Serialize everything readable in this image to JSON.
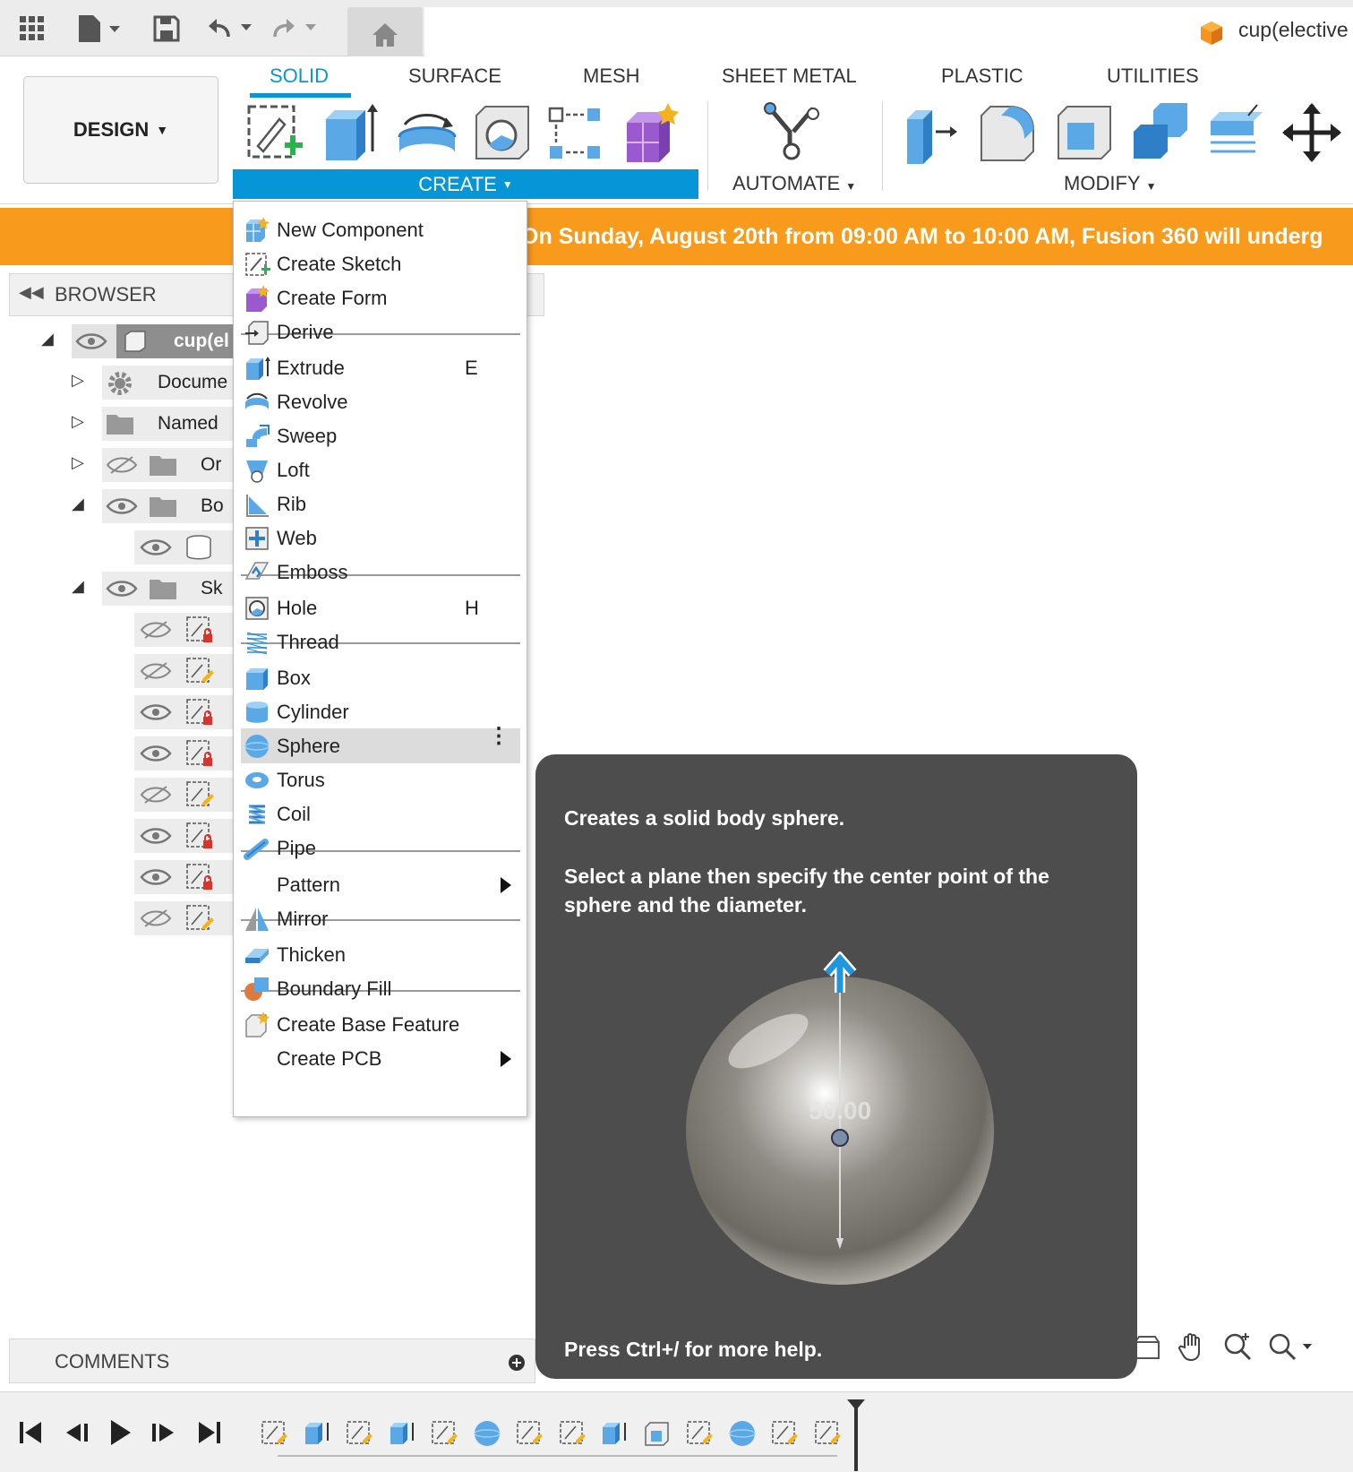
{
  "document": {
    "title": "cup(elective"
  },
  "workspace": {
    "label": "DESIGN"
  },
  "tabs": [
    {
      "label": "SOLID",
      "active": true
    },
    {
      "label": "SURFACE"
    },
    {
      "label": "MESH"
    },
    {
      "label": "SHEET METAL"
    },
    {
      "label": "PLASTIC"
    },
    {
      "label": "UTILITIES"
    }
  ],
  "groups": {
    "create": "CREATE",
    "automate": "AUTOMATE",
    "modify": "MODIFY"
  },
  "banner": {
    "text": "On Sunday, August 20th from 09:00 AM to 10:00 AM, Fusion 360 will underg"
  },
  "browser": {
    "title": "BROWSER",
    "items": [
      {
        "label": "cup(el",
        "icon": "component-icon"
      },
      {
        "label": "Docume",
        "icon": "gear-icon"
      },
      {
        "label": "Named",
        "icon": "folder-icon"
      },
      {
        "label": "Or",
        "icon": "folder-icon"
      },
      {
        "label": "Bo",
        "icon": "folder-icon"
      },
      {
        "label": "Sk",
        "icon": "folder-icon"
      }
    ]
  },
  "menu": {
    "items": [
      {
        "label": "New Component",
        "icon": "new-component-icon"
      },
      {
        "label": "Create Sketch",
        "icon": "create-sketch-icon"
      },
      {
        "label": "Create Form",
        "icon": "create-form-icon"
      },
      {
        "label": "Derive",
        "icon": "derive-icon"
      },
      {
        "label": "Extrude",
        "shortcut": "E",
        "icon": "extrude-icon"
      },
      {
        "label": "Revolve",
        "icon": "revolve-icon"
      },
      {
        "label": "Sweep",
        "icon": "sweep-icon"
      },
      {
        "label": "Loft",
        "icon": "loft-icon"
      },
      {
        "label": "Rib",
        "icon": "rib-icon"
      },
      {
        "label": "Web",
        "icon": "web-icon"
      },
      {
        "label": "Emboss",
        "icon": "emboss-icon"
      },
      {
        "label": "Hole",
        "shortcut": "H",
        "icon": "hole-icon"
      },
      {
        "label": "Thread",
        "icon": "thread-icon"
      },
      {
        "label": "Box",
        "icon": "box-icon"
      },
      {
        "label": "Cylinder",
        "icon": "cylinder-icon"
      },
      {
        "label": "Sphere",
        "icon": "sphere-icon",
        "highlighted": true
      },
      {
        "label": "Torus",
        "icon": "torus-icon"
      },
      {
        "label": "Coil",
        "icon": "coil-icon"
      },
      {
        "label": "Pipe",
        "icon": "pipe-icon"
      },
      {
        "label": "Pattern",
        "submenu": true
      },
      {
        "label": "Mirror",
        "icon": "mirror-icon"
      },
      {
        "label": "Thicken",
        "icon": "thicken-icon"
      },
      {
        "label": "Boundary Fill",
        "icon": "boundary-fill-icon"
      },
      {
        "label": "Create Base Feature",
        "icon": "base-feature-icon"
      },
      {
        "label": "Create PCB",
        "submenu": true
      }
    ]
  },
  "tooltip": {
    "line1": "Creates a solid body sphere.",
    "line2": "Select a plane then specify the center point of the sphere and the diameter.",
    "preview_value": "50.00",
    "help": "Press Ctrl+/ for more help."
  },
  "comments": {
    "title": "COMMENTS"
  },
  "colors": {
    "accent": "#0696d7",
    "banner": "#f89a1c",
    "tooltip_bg": "#4d4d4d"
  }
}
